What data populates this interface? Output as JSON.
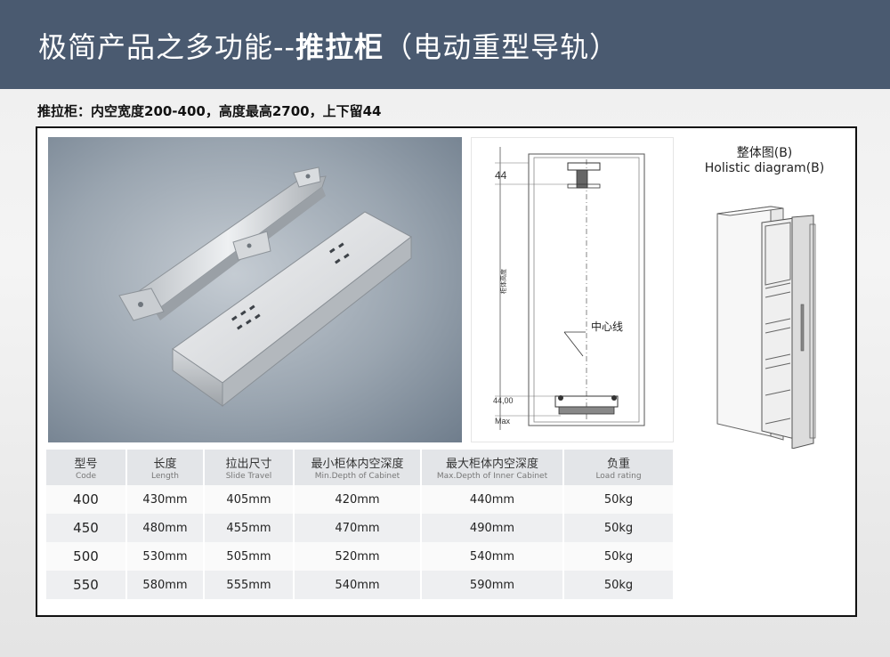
{
  "header": {
    "title_prefix": "极简产品之多功能--",
    "title_bold": "推拉柜",
    "title_suffix": "（电动重型导轨）"
  },
  "subtitle": "推拉柜：内空宽度200-400，高度最高2700，上下留44",
  "drawing": {
    "dim_top": "44",
    "dim_bottom": "44,00",
    "dim_max": "Max",
    "vertical_label": "柜体高度",
    "center_label": "中心线"
  },
  "holistic": {
    "title_cn": "整体图(B)",
    "title_en": "Holistic diagram(B)"
  },
  "table": {
    "headers": [
      {
        "cn": "型号",
        "en": "Code"
      },
      {
        "cn": "长度",
        "en": "Length"
      },
      {
        "cn": "拉出尺寸",
        "en": "Slide Travel"
      },
      {
        "cn": "最小柜体内空深度",
        "en": "Min.Depth of Cabinet"
      },
      {
        "cn": "最大柜体内空深度",
        "en": "Max.Depth of Inner Cabinet"
      },
      {
        "cn": "负重",
        "en": "Load rating"
      }
    ],
    "rows": [
      [
        "400",
        "430mm",
        "405mm",
        "420mm",
        "440mm",
        "50kg"
      ],
      [
        "450",
        "480mm",
        "455mm",
        "470mm",
        "490mm",
        "50kg"
      ],
      [
        "500",
        "530mm",
        "505mm",
        "520mm",
        "540mm",
        "50kg"
      ],
      [
        "550",
        "580mm",
        "555mm",
        "540mm",
        "590mm",
        "50kg"
      ]
    ]
  }
}
